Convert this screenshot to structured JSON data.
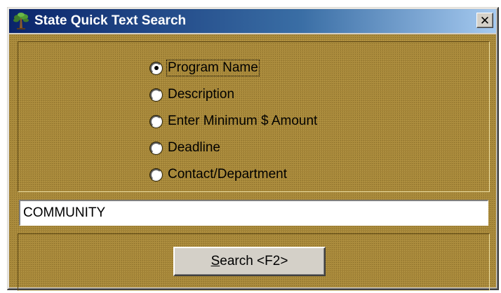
{
  "window": {
    "title": "State Quick Text Search",
    "close_glyph": "✕",
    "icon": "tree-icon"
  },
  "search_options": {
    "selected": "Program Name",
    "items": [
      {
        "label": "Program Name",
        "checked": true
      },
      {
        "label": "Description",
        "checked": false
      },
      {
        "label": "Enter Minimum $ Amount",
        "checked": false
      },
      {
        "label": "Deadline",
        "checked": false
      },
      {
        "label": "Contact/Department",
        "checked": false
      }
    ]
  },
  "search_field": {
    "value": "COMMUNITY"
  },
  "search_button": {
    "mnemonic": "S",
    "label_rest": "earch <F2>"
  },
  "colors": {
    "titlebar_start": "#0a246a",
    "titlebar_end": "#a6caf0",
    "panel_background": "#a8883a",
    "button_face": "#d4d0c8"
  }
}
